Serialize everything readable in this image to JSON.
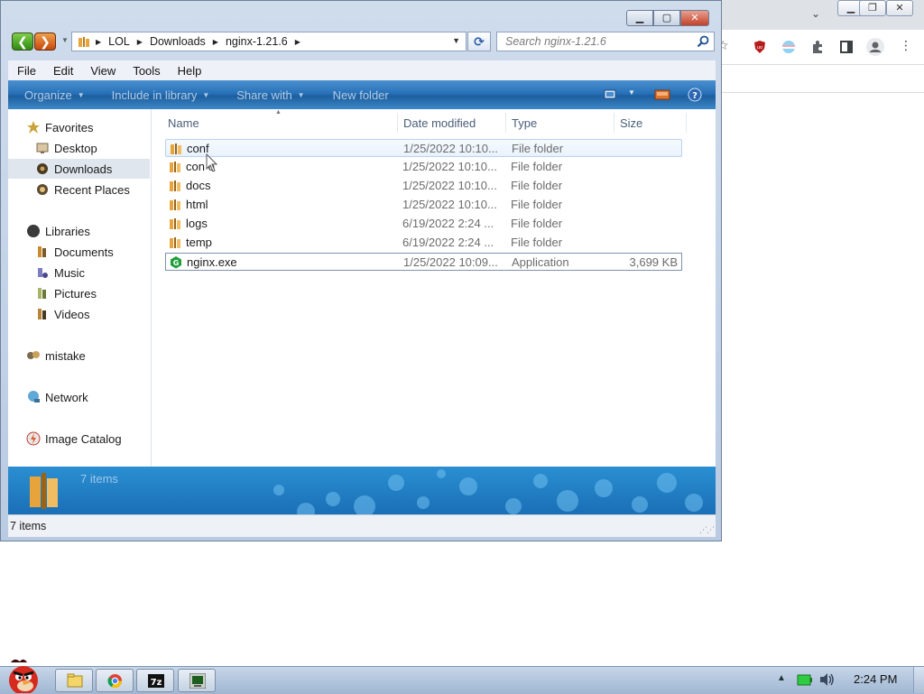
{
  "explorer": {
    "address": {
      "crumbs": [
        "LOL",
        "Downloads",
        "nginx-1.21.6"
      ]
    },
    "search_placeholder": "Search nginx-1.21.6",
    "menu": [
      "File",
      "Edit",
      "View",
      "Tools",
      "Help"
    ],
    "commands": {
      "organize": "Organize",
      "include_in_library": "Include in library",
      "share_with": "Share with",
      "new_folder": "New folder"
    },
    "nav": {
      "favorites": "Favorites",
      "desktop": "Desktop",
      "downloads": "Downloads",
      "recent_places": "Recent Places",
      "libraries": "Libraries",
      "documents": "Documents",
      "music": "Music",
      "pictures": "Pictures",
      "videos": "Videos",
      "mistake": "mistake",
      "network": "Network",
      "image_catalog": "Image Catalog"
    },
    "columns": {
      "name": "Name",
      "date_modified": "Date modified",
      "type": "Type",
      "size": "Size"
    },
    "files": [
      {
        "name": "conf",
        "date": "1/25/2022 10:10...",
        "type": "File folder",
        "size": ""
      },
      {
        "name": "con  o",
        "date": "1/25/2022 10:10...",
        "type": "File folder",
        "size": ""
      },
      {
        "name": "docs",
        "date": "1/25/2022 10:10...",
        "type": "File folder",
        "size": ""
      },
      {
        "name": "html",
        "date": "1/25/2022 10:10...",
        "type": "File folder",
        "size": ""
      },
      {
        "name": "logs",
        "date": "6/19/2022 2:24 ...",
        "type": "File folder",
        "size": ""
      },
      {
        "name": "temp",
        "date": "6/19/2022 2:24 ...",
        "type": "File folder",
        "size": ""
      },
      {
        "name": "nginx.exe",
        "date": "1/25/2022 10:09...",
        "type": "Application",
        "size": "3,699 KB"
      }
    ],
    "details_count": "7 items",
    "status_count": "7 items"
  },
  "taskbar": {
    "clock": "2:24 PM"
  },
  "colors": {
    "command_bar": "#2871b8",
    "details_pane": "#1a6fb6",
    "close_button": "#c4412a",
    "folder": "#e8a43c"
  }
}
